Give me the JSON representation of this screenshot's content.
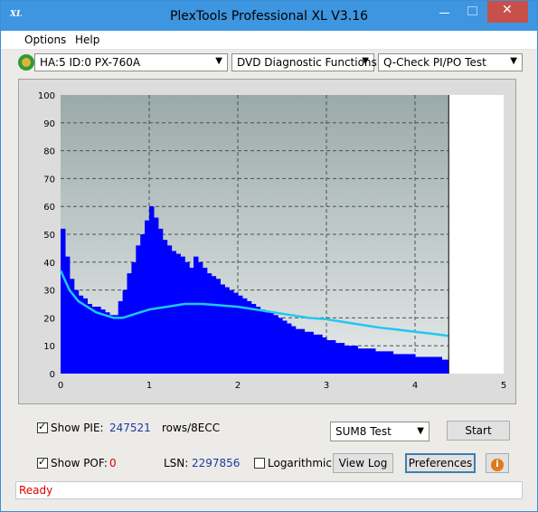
{
  "window": {
    "title": "PlexTools Professional XL V3.16",
    "app_icon_text": "XL",
    "minimize_glyph": "—",
    "maximize_glyph": "☐",
    "close_glyph": "✕"
  },
  "menu": {
    "items": [
      {
        "label": "Options"
      },
      {
        "label": "Help"
      }
    ]
  },
  "toolbar": {
    "drive": "HA:5 ID:0  PX-760A",
    "function": "DVD Diagnostic Functions",
    "test": "Q-Check PI/PO Test"
  },
  "chart_data": {
    "type": "bar",
    "title": "",
    "xlabel": "",
    "ylabel": "",
    "xlim": [
      0,
      5
    ],
    "ylim": [
      0,
      100
    ],
    "x_ticks": [
      "0",
      "1",
      "2",
      "3",
      "4",
      "5"
    ],
    "y_ticks": [
      "0",
      "10",
      "20",
      "30",
      "40",
      "50",
      "60",
      "70",
      "80",
      "90",
      "100"
    ],
    "grid": true,
    "end_marker_x": 4.38,
    "series": [
      {
        "kind": "bars",
        "color": "#0000ff",
        "x": [
          0.0,
          0.05,
          0.1,
          0.15,
          0.2,
          0.25,
          0.3,
          0.35,
          0.4,
          0.45,
          0.5,
          0.55,
          0.6,
          0.65,
          0.7,
          0.75,
          0.8,
          0.85,
          0.9,
          0.95,
          1.0,
          1.05,
          1.1,
          1.15,
          1.2,
          1.25,
          1.3,
          1.35,
          1.4,
          1.45,
          1.5,
          1.55,
          1.6,
          1.65,
          1.7,
          1.75,
          1.8,
          1.85,
          1.9,
          1.95,
          2.0,
          2.05,
          2.1,
          2.15,
          2.2,
          2.25,
          2.3,
          2.35,
          2.4,
          2.45,
          2.5,
          2.55,
          2.6,
          2.65,
          2.7,
          2.75,
          2.8,
          2.85,
          2.9,
          2.95,
          3.0,
          3.05,
          3.1,
          3.15,
          3.2,
          3.25,
          3.3,
          3.35,
          3.4,
          3.45,
          3.5,
          3.55,
          3.6,
          3.65,
          3.7,
          3.75,
          3.8,
          3.85,
          3.9,
          3.95,
          4.0,
          4.05,
          4.1,
          4.15,
          4.2,
          4.25,
          4.3,
          4.35
        ],
        "values": [
          52,
          42,
          34,
          30,
          28,
          27,
          25,
          24,
          24,
          23,
          22,
          21,
          21,
          26,
          30,
          36,
          40,
          46,
          50,
          55,
          60,
          56,
          52,
          48,
          46,
          44,
          43,
          42,
          40,
          38,
          42,
          40,
          38,
          36,
          35,
          34,
          32,
          31,
          30,
          29,
          28,
          27,
          26,
          25,
          24,
          23,
          22,
          22,
          21,
          20,
          19,
          18,
          17,
          16,
          16,
          15,
          15,
          14,
          14,
          13,
          12,
          12,
          11,
          11,
          10,
          10,
          10,
          9,
          9,
          9,
          9,
          8,
          8,
          8,
          8,
          7,
          7,
          7,
          7,
          7,
          6,
          6,
          6,
          6,
          6,
          6,
          5,
          5
        ]
      },
      {
        "kind": "line",
        "color": "#1fc8f0",
        "x": [
          0.0,
          0.1,
          0.2,
          0.3,
          0.4,
          0.5,
          0.6,
          0.7,
          0.8,
          0.9,
          1.0,
          1.2,
          1.4,
          1.6,
          1.8,
          2.0,
          2.2,
          2.4,
          2.6,
          2.8,
          3.0,
          3.2,
          3.4,
          3.6,
          3.8,
          4.0,
          4.2,
          4.38
        ],
        "values": [
          37,
          30,
          26,
          24,
          22,
          21,
          20,
          20,
          21,
          22,
          23,
          24,
          25,
          25,
          24.5,
          24,
          23,
          22,
          21,
          20,
          19.5,
          18.5,
          17.5,
          16.5,
          15.8,
          15,
          14.3,
          13.5
        ]
      }
    ]
  },
  "controls": {
    "show_pie_label": "Show PIE:",
    "pie_value": "247521",
    "rows_label": "rows/8ECC",
    "show_poe_label": "Show POF:",
    "poe_value": "0",
    "lsn_label": "LSN:",
    "lsn_value": "2297856",
    "logarithmic_label": "Logarithmic",
    "sum_test": "SUM8 Test",
    "start_label": "Start",
    "view_log_label": "View Log",
    "preferences_label": "Preferences",
    "checked_glyph": "✓",
    "info_glyph": "i"
  },
  "status": {
    "text": "Ready",
    "color": "#e00000"
  }
}
